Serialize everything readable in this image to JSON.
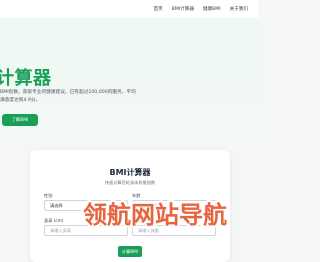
{
  "nav": {
    "items": [
      "首页",
      "BMI计算器",
      "健康BMI",
      "关于我们"
    ]
  },
  "hero": {
    "title": "计算器",
    "description": "BMI指数，获取专业的健康建议。已有超过100,000的服务，平均满意度达到4.9分。",
    "button_label": "了解BMI"
  },
  "calculator": {
    "title": "BMI计算器",
    "subtitle": "快速计算您的身体质量指数",
    "gender_label": "性别",
    "gender_value": "请选择",
    "age_label": "年龄",
    "age_placeholder": "请输入年龄",
    "height_label": "身高 (cm)",
    "height_placeholder": "请输入身高",
    "weight_label": "体重 (kg)",
    "weight_placeholder": "请输入体重",
    "button_label": "计算BMI"
  },
  "watermark": {
    "text": "领航网站导航",
    "color": "#e4572e"
  },
  "colors": {
    "accent": "#18a058"
  }
}
